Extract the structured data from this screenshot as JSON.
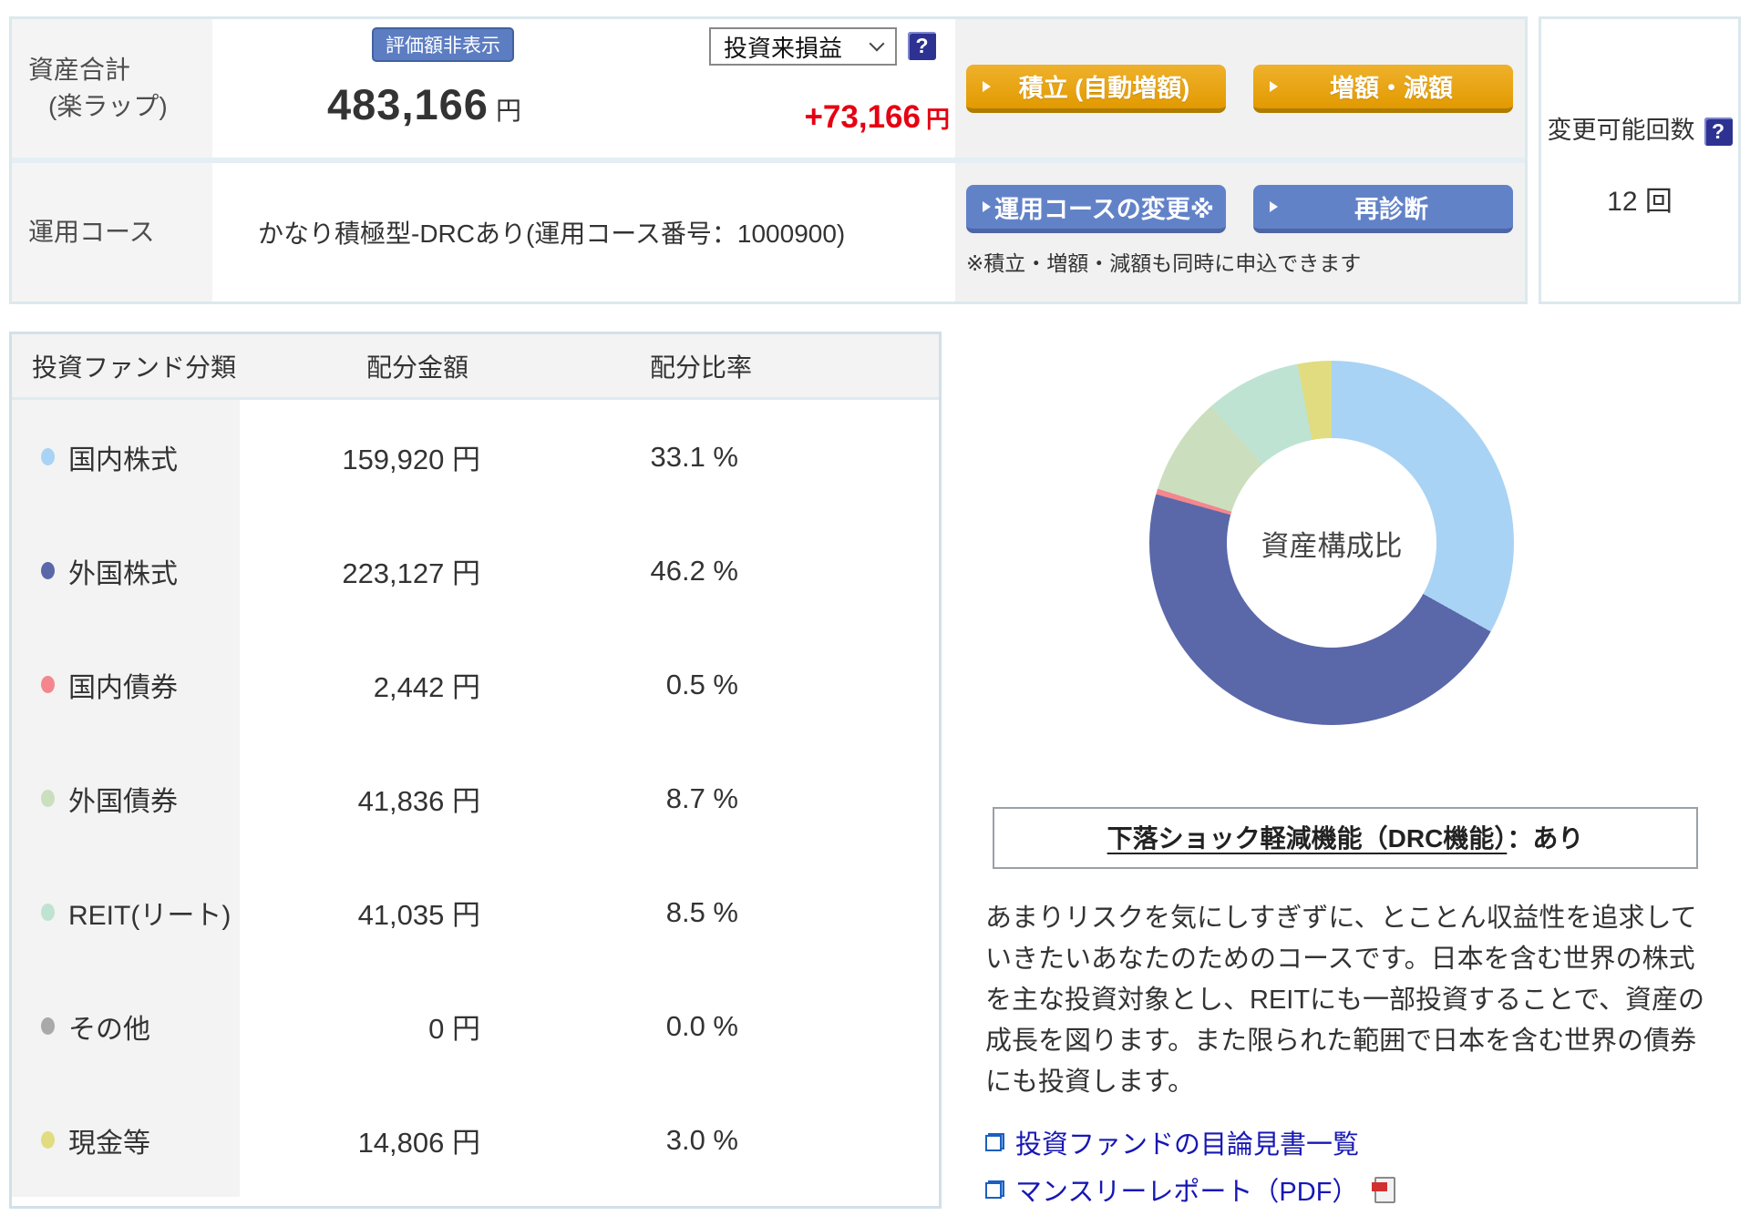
{
  "header": {
    "asset_label_line1": "資産合計",
    "asset_label_line2": "(楽ラップ)",
    "hide_value_badge": "評価額非表示",
    "total_amount": "483,166",
    "total_unit": "円",
    "profit_dropdown_value": "投資来損益",
    "profit_help_icon": "?",
    "profit_value": "+73,166",
    "profit_unit": "円",
    "tsumitate_button": "積立 (自動増額)",
    "zougaku_button": "増額・減額",
    "course_label": "運用コース",
    "course_value": "かなり積極型-DRCあり(運用コース番号：1000900)",
    "course_change_button": "運用コースの変更※",
    "rediagnosis_button": "再診断",
    "note": "※積立・増額・減額も同時に申込できます",
    "change_count_label": "変更可能回数",
    "change_count_help_icon": "?",
    "change_count_value": "12 回"
  },
  "table": {
    "headers": [
      "投資ファンド分類",
      "配分金額",
      "配分比率"
    ],
    "rows": [
      {
        "label": "国内株式",
        "amount": "159,920 円",
        "ratio": "33.1 %",
        "color": "#a9d3f4"
      },
      {
        "label": "外国株式",
        "amount": "223,127 円",
        "ratio": "46.2 %",
        "color": "#5a68a9"
      },
      {
        "label": "国内債券",
        "amount": "2,442 円",
        "ratio": "0.5 %",
        "color": "#f4878d"
      },
      {
        "label": "外国債券",
        "amount": "41,836 円",
        "ratio": "8.7 %",
        "color": "#cbdfbe"
      },
      {
        "label": "REIT(リート)",
        "amount": "41,035 円",
        "ratio": "8.5 %",
        "color": "#bee3d3"
      },
      {
        "label": "その他",
        "amount": "0 円",
        "ratio": "0.0 %",
        "color": "#a9a9a9"
      },
      {
        "label": "現金等",
        "amount": "14,806 円",
        "ratio": "3.0 %",
        "color": "#e1dc80"
      }
    ]
  },
  "chart_data": {
    "type": "pie",
    "style": "donut",
    "title": "資産構成比",
    "categories": [
      "国内株式",
      "外国株式",
      "国内債券",
      "外国債券",
      "REIT(リート)",
      "その他",
      "現金等"
    ],
    "values": [
      33.1,
      46.2,
      0.5,
      8.7,
      8.5,
      0.0,
      3.0
    ],
    "colors": [
      "#a9d3f4",
      "#5a68a9",
      "#f4878d",
      "#cbdfbe",
      "#bee3d3",
      "#a9a9a9",
      "#e1dc80"
    ],
    "start_angle_deg": 0,
    "direction": "clockwise",
    "center_label": "資産構成比",
    "legend_position": "table-left"
  },
  "right": {
    "donut_center": "資産構成比",
    "drc_title_underlined": "下落ショック軽減機能（DRC機能）",
    "drc_title_value": "：あり",
    "description": "あまりリスクを気にしすぎずに、とことん収益性を追求していきたいあなたのためのコースです。日本を含む世界の株式を主な投資対象とし、REITにも一部投資することで、資産の成長を図ります。また限られた範囲で日本を含む世界の債券にも投資します。",
    "links": [
      {
        "label": "投資ファンドの目論見書一覧",
        "pdf": false
      },
      {
        "label": "マンスリーレポート（PDF）",
        "pdf": true
      }
    ]
  }
}
